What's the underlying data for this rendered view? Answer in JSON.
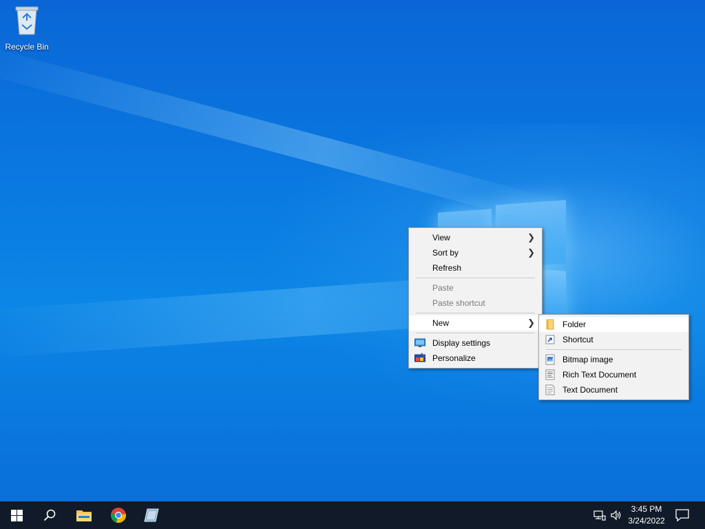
{
  "desktop": {
    "icons": [
      {
        "label": "Recycle Bin",
        "icon": "recycle-bin-icon"
      }
    ]
  },
  "context_menu": {
    "items": [
      {
        "label": "View",
        "has_submenu": true
      },
      {
        "label": "Sort by",
        "has_submenu": true
      },
      {
        "label": "Refresh"
      },
      {
        "label": "Paste",
        "disabled": true
      },
      {
        "label": "Paste shortcut",
        "disabled": true
      },
      {
        "label": "New",
        "has_submenu": true,
        "highlighted": true
      },
      {
        "label": "Display settings",
        "icon": "display-icon"
      },
      {
        "label": "Personalize",
        "icon": "personalize-icon"
      }
    ],
    "chevron": ">"
  },
  "new_submenu": {
    "items": [
      {
        "label": "Folder",
        "icon": "folder-icon",
        "highlighted": true
      },
      {
        "label": "Shortcut",
        "icon": "shortcut-icon"
      },
      {
        "label": "Bitmap image",
        "icon": "bitmap-icon"
      },
      {
        "label": "Rich Text Document",
        "icon": "rtf-document-icon"
      },
      {
        "label": "Text Document",
        "icon": "text-document-icon"
      }
    ]
  },
  "taskbar": {
    "pinned": [
      {
        "name": "start",
        "icon": "windows-start-icon"
      },
      {
        "name": "search",
        "icon": "search-icon"
      },
      {
        "name": "file-explorer",
        "icon": "file-explorer-icon"
      },
      {
        "name": "chrome",
        "icon": "chrome-icon"
      },
      {
        "name": "app",
        "icon": "app-icon"
      }
    ],
    "clock": {
      "time": "3:45 PM",
      "date": "3/24/2022"
    },
    "colors": {
      "background": "#101a28",
      "accent": "#0a78e0"
    }
  }
}
